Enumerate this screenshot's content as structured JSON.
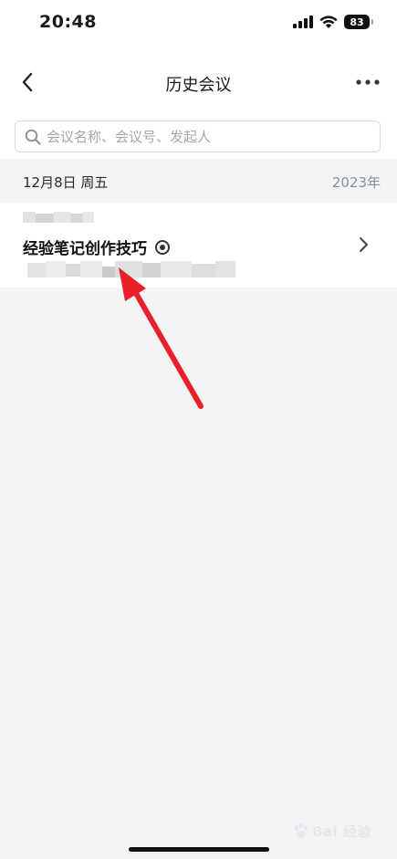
{
  "status_bar": {
    "time": "20:48",
    "battery": "83"
  },
  "nav": {
    "title": "历史会议"
  },
  "search": {
    "placeholder": "会议名称、会议号、发起人"
  },
  "section": {
    "date": "12月8日 周五",
    "year": "2023年"
  },
  "meeting": {
    "title": "经验笔记创作技巧"
  },
  "watermark": {
    "text": "Bai 经验"
  },
  "colors": {
    "accent_arrow": "#e8202a",
    "background": "#f3f4f6",
    "card": "#ffffff"
  },
  "icons": {
    "back": "chevron-left-icon",
    "more": "more-dots-icon",
    "search": "search-icon",
    "record": "record-icon",
    "chevron": "chevron-right-icon"
  }
}
